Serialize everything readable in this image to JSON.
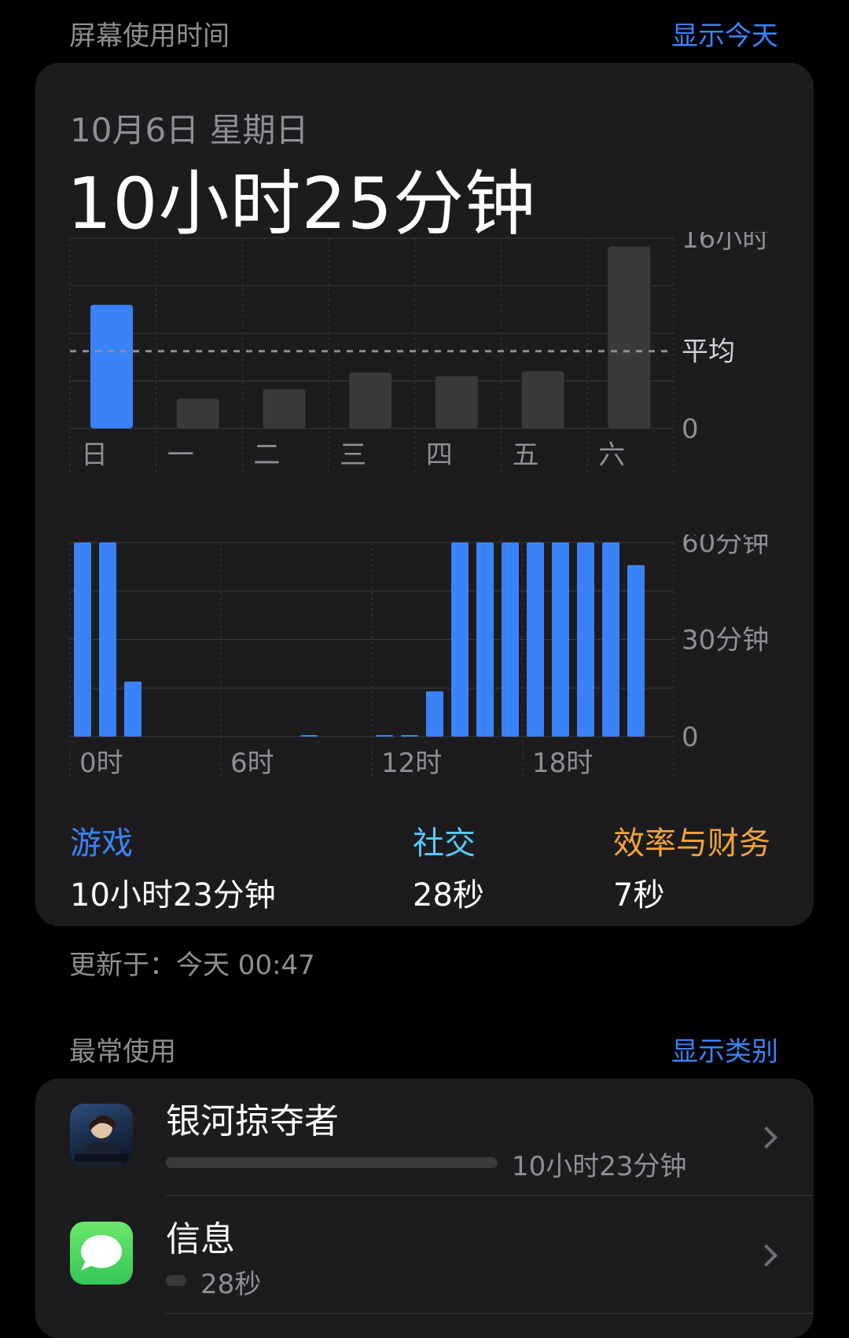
{
  "header": {
    "title": "屏幕使用时间",
    "action": "显示今天"
  },
  "summary": {
    "date": "10月6日 星期日",
    "total": "10小时25分钟"
  },
  "colors": {
    "accent": "#3a82f7",
    "bar_gray": "#3a3a3c",
    "teal": "#5ac8fa",
    "orange": "#f2a33a",
    "card": "#1c1c1e"
  },
  "chart_data": [
    {
      "type": "bar",
      "categories": [
        "日",
        "一",
        "二",
        "三",
        "四",
        "五",
        "六"
      ],
      "values": [
        10.4,
        2.5,
        3.3,
        4.7,
        4.4,
        4.8,
        15.3
      ],
      "highlight_index": 0,
      "average": 6.5,
      "average_label": "平均",
      "ylim": [
        0,
        16
      ],
      "y_tick_labels": [
        "16小时",
        "0"
      ],
      "grid": true
    },
    {
      "type": "bar",
      "hours": [
        0,
        1,
        2,
        3,
        4,
        5,
        6,
        7,
        8,
        9,
        10,
        11,
        12,
        13,
        14,
        15,
        16,
        17,
        18,
        19,
        20,
        21,
        22,
        23
      ],
      "values": [
        60,
        60,
        17,
        0,
        0,
        0,
        0,
        0,
        0,
        0.3,
        0,
        0,
        0.3,
        0.3,
        14,
        60,
        60,
        60,
        60,
        60,
        60,
        60,
        53,
        0
      ],
      "x_tick_labels": [
        "0时",
        "6时",
        "12时",
        "18时"
      ],
      "y_tick_labels": [
        "60分钟",
        "30分钟",
        "0"
      ],
      "ylim": [
        0,
        60
      ],
      "grid": true
    }
  ],
  "categories": [
    {
      "name": "游戏",
      "value": "10小时23分钟",
      "color": "#3a82f7"
    },
    {
      "name": "社交",
      "value": "28秒",
      "color": "#5ac8fa"
    },
    {
      "name": "效率与财务",
      "value": "7秒",
      "color": "#f2a33a"
    }
  ],
  "updated": "更新于：今天 00:47",
  "most_used": {
    "title": "最常使用",
    "action": "显示类别",
    "apps": [
      {
        "name": "银河掠夺者",
        "time": "10小时23分钟",
        "icon": "game-app-icon",
        "usage": 1.0
      },
      {
        "name": "信息",
        "time": "28秒",
        "icon": "messages-icon",
        "usage": 0.06
      }
    ]
  }
}
